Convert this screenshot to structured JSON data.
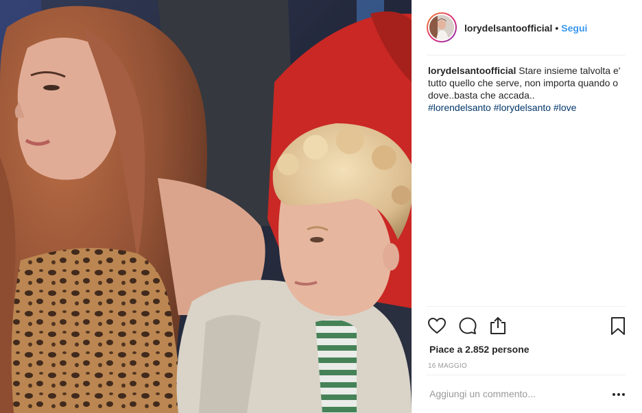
{
  "header": {
    "username": "lorydelsantoofficial",
    "separator": "•",
    "follow_label": "Segui"
  },
  "caption": {
    "username": "lorydelsantoofficial",
    "text": "Stare insieme talvolta e' tutto quello che serve, non importa quando o dove..basta che accada..",
    "hashtags": [
      "#lorendelsanto",
      "#lorydelsanto",
      "#love"
    ]
  },
  "actions": {
    "like_icon": "heart-icon",
    "comment_icon": "comment-icon",
    "share_icon": "share-icon",
    "save_icon": "bookmark-icon"
  },
  "likes_text": "Piace a 2.852 persone",
  "date": "16 MAGGIO",
  "comment": {
    "placeholder": "Aggiungi un commento...",
    "more_icon": "more-options-icon"
  },
  "colors": {
    "accent": "#3897f0",
    "hashtag": "#003569",
    "text": "#262626",
    "muted": "#999999"
  }
}
